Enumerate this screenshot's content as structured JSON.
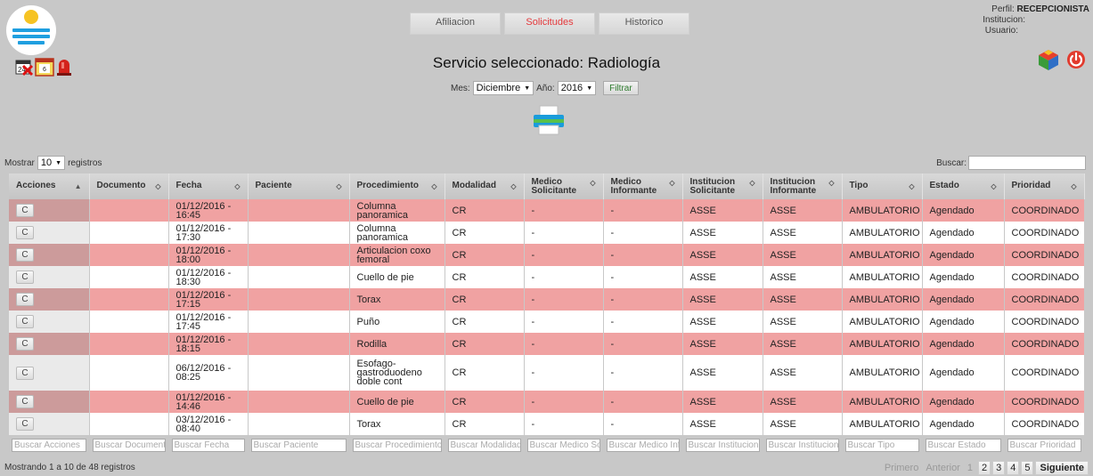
{
  "tabs": [
    {
      "label": "Afiliacion",
      "active": false
    },
    {
      "label": "Solicitudes",
      "active": true
    },
    {
      "label": "Historico",
      "active": false
    }
  ],
  "user": {
    "perfil_label": "Perfil:",
    "perfil_value": "RECEPCIONISTA",
    "institucion_label": "Institucion:",
    "usuario_label": "Usuario:"
  },
  "title": "Servicio seleccionado: Radiología",
  "filter": {
    "mes_label": "Mes:",
    "mes_value": "Diciembre",
    "anio_label": "Año:",
    "anio_value": "2016",
    "button": "Filtrar"
  },
  "controls": {
    "mostrar_label": "Mostrar",
    "mostrar_value": "10",
    "registros_label": "registros",
    "buscar_label": "Buscar:"
  },
  "columns": [
    "Acciones",
    "Documento",
    "Fecha",
    "Paciente",
    "Procedimiento",
    "Modalidad",
    "Medico Solicitante",
    "Medico Informante",
    "Institucion Solicitante",
    "Institucion Informante",
    "Tipo",
    "Estado",
    "Prioridad"
  ],
  "rows": [
    {
      "accion": "C",
      "documento": "",
      "fecha": "01/12/2016 - 16:45",
      "paciente": "",
      "procedimiento": "Columna panoramica",
      "modalidad": "CR",
      "med_sol": "-",
      "med_inf": "-",
      "inst_sol": "ASSE",
      "inst_inf": "ASSE",
      "tipo": "AMBULATORIO",
      "estado": "Agendado",
      "prioridad": "COORDINADO"
    },
    {
      "accion": "C",
      "documento": "",
      "fecha": "01/12/2016 - 17:30",
      "paciente": "",
      "procedimiento": "Columna panoramica",
      "modalidad": "CR",
      "med_sol": "-",
      "med_inf": "-",
      "inst_sol": "ASSE",
      "inst_inf": "ASSE",
      "tipo": "AMBULATORIO",
      "estado": "Agendado",
      "prioridad": "COORDINADO"
    },
    {
      "accion": "C",
      "documento": "",
      "fecha": "01/12/2016 - 18:00",
      "paciente": "",
      "procedimiento": "Articulacion coxo femoral",
      "modalidad": "CR",
      "med_sol": "-",
      "med_inf": "-",
      "inst_sol": "ASSE",
      "inst_inf": "ASSE",
      "tipo": "AMBULATORIO",
      "estado": "Agendado",
      "prioridad": "COORDINADO"
    },
    {
      "accion": "C",
      "documento": "",
      "fecha": "01/12/2016 - 18:30",
      "paciente": "",
      "procedimiento": "Cuello de pie",
      "modalidad": "CR",
      "med_sol": "-",
      "med_inf": "-",
      "inst_sol": "ASSE",
      "inst_inf": "ASSE",
      "tipo": "AMBULATORIO",
      "estado": "Agendado",
      "prioridad": "COORDINADO"
    },
    {
      "accion": "C",
      "documento": "",
      "fecha": "01/12/2016 - 17:15",
      "paciente": "",
      "procedimiento": "Torax",
      "modalidad": "CR",
      "med_sol": "-",
      "med_inf": "-",
      "inst_sol": "ASSE",
      "inst_inf": "ASSE",
      "tipo": "AMBULATORIO",
      "estado": "Agendado",
      "prioridad": "COORDINADO"
    },
    {
      "accion": "C",
      "documento": "",
      "fecha": "01/12/2016 - 17:45",
      "paciente": "",
      "procedimiento": "Puño",
      "modalidad": "CR",
      "med_sol": "-",
      "med_inf": "-",
      "inst_sol": "ASSE",
      "inst_inf": "ASSE",
      "tipo": "AMBULATORIO",
      "estado": "Agendado",
      "prioridad": "COORDINADO"
    },
    {
      "accion": "C",
      "documento": "",
      "fecha": "01/12/2016 - 18:15",
      "paciente": "",
      "procedimiento": "Rodilla",
      "modalidad": "CR",
      "med_sol": "-",
      "med_inf": "-",
      "inst_sol": "ASSE",
      "inst_inf": "ASSE",
      "tipo": "AMBULATORIO",
      "estado": "Agendado",
      "prioridad": "COORDINADO"
    },
    {
      "accion": "C",
      "documento": "",
      "fecha": "06/12/2016 - 08:25",
      "paciente": "",
      "procedimiento": "Esofago-gastroduodeno doble cont",
      "modalidad": "CR",
      "med_sol": "-",
      "med_inf": "-",
      "inst_sol": "ASSE",
      "inst_inf": "ASSE",
      "tipo": "AMBULATORIO",
      "estado": "Agendado",
      "prioridad": "COORDINADO"
    },
    {
      "accion": "C",
      "documento": "",
      "fecha": "01/12/2016 - 14:46",
      "paciente": "",
      "procedimiento": "Cuello de pie",
      "modalidad": "CR",
      "med_sol": "-",
      "med_inf": "-",
      "inst_sol": "ASSE",
      "inst_inf": "ASSE",
      "tipo": "AMBULATORIO",
      "estado": "Agendado",
      "prioridad": "COORDINADO"
    },
    {
      "accion": "C",
      "documento": "",
      "fecha": "03/12/2016 - 08:40",
      "paciente": "",
      "procedimiento": "Torax",
      "modalidad": "CR",
      "med_sol": "-",
      "med_inf": "-",
      "inst_sol": "ASSE",
      "inst_inf": "ASSE",
      "tipo": "AMBULATORIO",
      "estado": "Agendado",
      "prioridad": "COORDINADO"
    }
  ],
  "column_search_placeholders": [
    "Buscar Acciones",
    "Buscar Documento",
    "Buscar Fecha",
    "Buscar Paciente",
    "Buscar Procedimiento",
    "Buscar Modalidad",
    "Buscar Medico Solicitante",
    "Buscar Medico Informante",
    "Buscar Institucion Solicitante",
    "Buscar Institucion Informante",
    "Buscar Tipo",
    "Buscar Estado",
    "Buscar Prioridad"
  ],
  "footer": {
    "info": "Mostrando 1 a 10 de 48 registros",
    "primero": "Primero",
    "anterior": "Anterior",
    "pages": [
      "1",
      "2",
      "3",
      "4",
      "5"
    ],
    "current_page": "1",
    "siguiente": "Siguiente"
  },
  "colors": {
    "row_highlight": "#f0a2a2",
    "active_tab": "#e4383b",
    "background": "#c8c8c8"
  },
  "icons": [
    "app-logo-icon",
    "calendar-cancel-icon",
    "calendar-icon",
    "alarm-siren-icon",
    "printer-icon",
    "settings-cube-icon",
    "power-icon"
  ]
}
